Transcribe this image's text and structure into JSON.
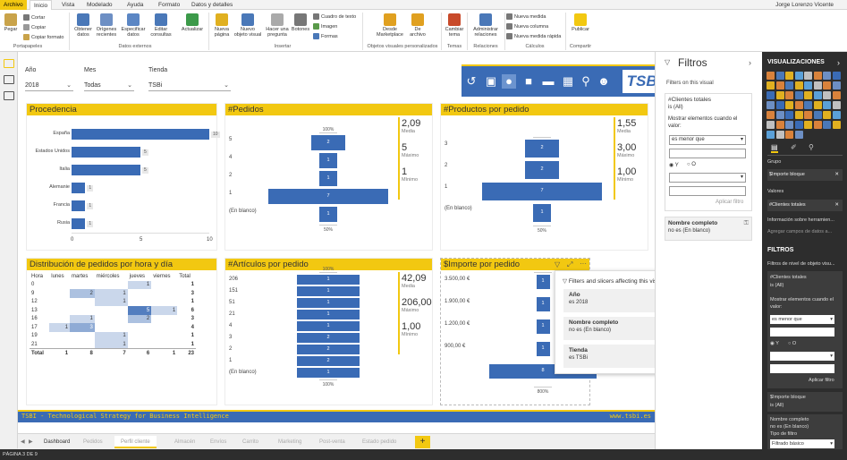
{
  "ribbon": {
    "tabs": [
      "Archivo",
      "Inicio",
      "Vista",
      "Modelado",
      "Ayuda",
      "Formato",
      "Datos y detalles"
    ],
    "user": "Jorge Lorenzo Vicente",
    "buttons": {
      "pegar": "Pegar",
      "cortar": "Cortar",
      "copiar": "Copiar",
      "copiar_formato": "Copiar formato",
      "obtener_datos": "Obtener datos",
      "origenes": "Orígenes recientes",
      "especificar": "Especificar datos",
      "editar": "Editar consultas",
      "actualizar": "Actualizar",
      "nueva_pagina": "Nueva página",
      "nuevo_objeto": "Nuevo objeto visual",
      "hacer_pregunta": "Hacer una pregunta",
      "botones": "Botones",
      "cuadro_texto": "Cuadro de texto",
      "imagen": "Imagen",
      "formas": "Formas",
      "desde_marketplace": "Desde Marketplace",
      "de_archivo": "De archivo",
      "cambiar_tema": "Cambiar tema",
      "administrar": "Administrar relaciones",
      "nueva_medida": "Nueva medida",
      "nueva_columna": "Nueva columna",
      "nueva_medida_rapida": "Nueva medida rápida",
      "publicar": "Publicar"
    },
    "groups": [
      "Portapapeles",
      "Datos externos",
      "Insertar",
      "Objetos visuales personalizados",
      "Temas",
      "Relaciones",
      "Cálculos",
      "Compartir"
    ]
  },
  "slicers": {
    "year_label": "Año",
    "year_value": "2018",
    "month_label": "Mes",
    "month_value": "Todas",
    "store_label": "Tienda",
    "store_value": "TSBi"
  },
  "logo": "TSBi",
  "procedencia": {
    "title": "Procedencia",
    "rows": [
      {
        "label": "España",
        "value": 10
      },
      {
        "label": "Estados Unidos",
        "value": 5
      },
      {
        "label": "Italia",
        "value": 5
      },
      {
        "label": "Alemanie",
        "value": 1
      },
      {
        "label": "Francia",
        "value": 1
      },
      {
        "label": "Rusia",
        "value": 1
      }
    ],
    "axis": [
      "0",
      "5",
      "10"
    ],
    "max": 10
  },
  "pedidos": {
    "title": "#Pedidos",
    "rows": [
      {
        "label": "5",
        "value": 2,
        "label_value": "2"
      },
      {
        "label": "4",
        "value": 1,
        "label_value": "1"
      },
      {
        "label": "2",
        "value": 1,
        "label_value": "1"
      },
      {
        "label": "1",
        "value": 7,
        "label_value": "7"
      },
      {
        "label": "(En blanco)",
        "value": 1,
        "label_value": "1"
      }
    ],
    "top_pct": "100%",
    "bottom_pct": "50%",
    "kpis": [
      {
        "value": "2,09",
        "label": "Media"
      },
      {
        "value": "5",
        "label": "Máximo"
      },
      {
        "value": "1",
        "label": "Mínimo"
      }
    ]
  },
  "productos": {
    "title": "#Productos por pedido",
    "rows": [
      {
        "label": "3",
        "value": 2,
        "label_value": "2"
      },
      {
        "label": "2",
        "value": 2,
        "label_value": "2"
      },
      {
        "label": "1",
        "value": 7,
        "label_value": "7"
      },
      {
        "label": "(En blanco)",
        "value": 1,
        "label_value": "1"
      }
    ],
    "top_pct": "",
    "bottom_pct": "50%",
    "kpis": [
      {
        "value": "1,55",
        "label": "Media"
      },
      {
        "value": "3,00",
        "label": "Máximo"
      },
      {
        "value": "1,00",
        "label": "Mínimo"
      }
    ]
  },
  "distribucion": {
    "title": "Distribución de pedidos por hora y día",
    "headers": [
      "Hora",
      "lunes",
      "martes",
      "miércoles",
      "jueves",
      "viernes",
      "Total"
    ],
    "rows": [
      [
        "0",
        "",
        "",
        "",
        "1",
        "",
        "1"
      ],
      [
        "9",
        "",
        "2",
        "1",
        "",
        "",
        "3"
      ],
      [
        "12",
        "",
        "",
        "1",
        "",
        "",
        "1"
      ],
      [
        "13",
        "",
        "",
        "",
        "5",
        "1",
        "6"
      ],
      [
        "16",
        "",
        "1",
        "",
        "2",
        "",
        "3"
      ],
      [
        "17",
        "1",
        "3",
        "",
        "",
        "",
        "4"
      ],
      [
        "19",
        "",
        "",
        "1",
        "",
        "",
        "1"
      ],
      [
        "21",
        "",
        "",
        "1",
        "",
        "",
        "1"
      ]
    ],
    "total": [
      "Total",
      "1",
      "8",
      "7",
      "6",
      "1",
      "23"
    ]
  },
  "articulos": {
    "title": "#Artículos por pedido",
    "rows": [
      {
        "label": "206",
        "value": 1,
        "label_value": "1"
      },
      {
        "label": "151",
        "value": 1,
        "label_value": "1"
      },
      {
        "label": "51",
        "value": 1,
        "label_value": "1"
      },
      {
        "label": "21",
        "value": 1,
        "label_value": "1"
      },
      {
        "label": "4",
        "value": 1,
        "label_value": "1"
      },
      {
        "label": "3",
        "value": 2,
        "label_value": "2"
      },
      {
        "label": "2",
        "value": 2,
        "label_value": "2"
      },
      {
        "label": "1",
        "value": 2,
        "label_value": "2"
      },
      {
        "label": "(En blanco)",
        "value": 1,
        "label_value": "1"
      }
    ],
    "top_pct": "100%",
    "bottom_pct": "100%",
    "kpis": [
      {
        "value": "42,09",
        "label": "Media"
      },
      {
        "value": "206,00",
        "label": "Máximo"
      },
      {
        "value": "1,00",
        "label": "Mínimo"
      }
    ]
  },
  "importe": {
    "title": "$Importe por pedido",
    "rows": [
      {
        "label": "3.500,00 €",
        "value": 1
      },
      {
        "label": "1.900,00 €",
        "value": 1
      },
      {
        "label": "1.200,00 €",
        "value": 1
      },
      {
        "label": "900,00 €",
        "value": 1
      },
      {
        "label": "",
        "value": 8,
        "label_value": "8"
      }
    ],
    "bottom_pct": "800%"
  },
  "tooltip": {
    "header": "Filters and slicers affecting this visual",
    "items": [
      {
        "title": "Año",
        "text": "es 2018"
      },
      {
        "title": "Nombre completo",
        "text": "no es (En blanco)"
      },
      {
        "title": "Tienda",
        "text": "es TSBi"
      }
    ]
  },
  "footer": {
    "left": "TSBI - Technological Strategy for Business Intelligence",
    "right": "www.tsbi.es"
  },
  "pagetabs": [
    "Dashboard",
    "Pedidos",
    "Perfil cliente",
    "Almacén",
    "Envíos",
    "Carrito",
    "Marketing",
    "Post-venta",
    "Estado pedido"
  ],
  "current_page": "Perfil cliente",
  "status": "PÁGINA 3 DE 9",
  "filters": {
    "title": "Filtros",
    "subtitle": "Filters on this visual",
    "card1_title": "#Clientes totales",
    "card1_sub": "is (All)",
    "show_items": "Mostrar elementos cuando el valor:",
    "condition": "es menor que",
    "and_label": "Y",
    "or_label": "O",
    "apply": "Aplicar filtro",
    "card2_title": "Nombre completo",
    "card2_sub": "no es (En blanco)"
  },
  "viz": {
    "title": "VISUALIZACIONES",
    "grupo": "Grupo",
    "grupo_field": "$Importe bloque",
    "valores": "Valores",
    "valores_field": "#Clientes totales",
    "tooltip_info": "Información sobre herramien...",
    "tooltip_add": "Agregar campos de datos a...",
    "filtros": "FILTROS",
    "filtros_sub": "Filtros de nivel de objeto visu...",
    "f1_title": "#Clientes totales",
    "f1_sub": "is (All)",
    "f1_show": "Mostrar elementos cuando el valor:",
    "f1_cond": "es menor que",
    "and_label": "Y",
    "or_label": "O",
    "apply": "Aplicar filtro",
    "f2_title": "$Importe bloque",
    "f2_sub": "is (All)",
    "f3_title": "Nombre completo",
    "f3_sub": "no es (En blanco)",
    "f3_type": "Tipo de filtro",
    "f3_type_val": "Filtrado básico"
  },
  "colors": {
    "accent": "#f2c811",
    "bar": "#3a6bb5",
    "dark": "#2d2d2d"
  }
}
